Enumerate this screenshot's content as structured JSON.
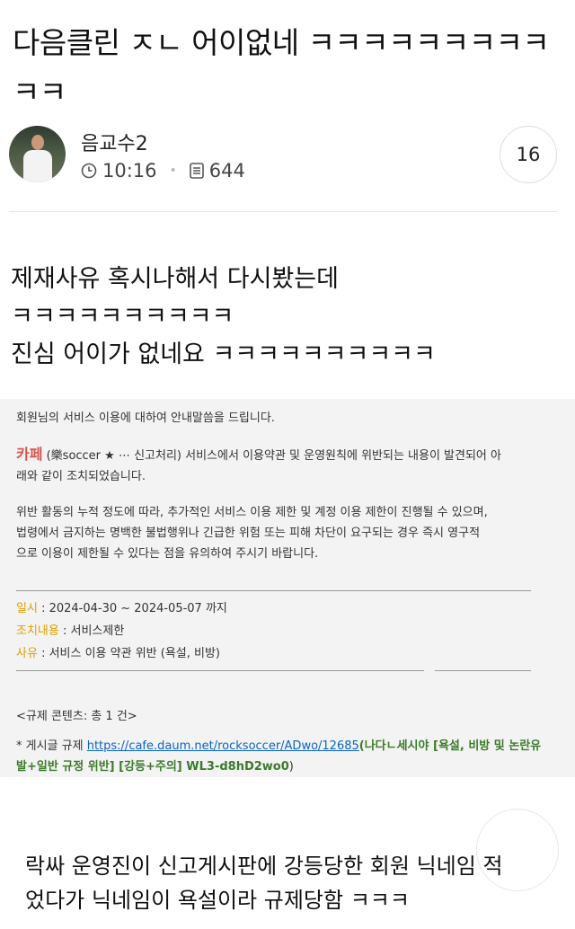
{
  "post": {
    "title": "다음클린 ㅈㄴ 어이없네 ㅋㅋㅋㅋㅋㅋㅋㅋㅋㅋㅋ"
  },
  "author": {
    "name": "음교수2",
    "time": "10:16",
    "views": "644",
    "comment_count": "16",
    "time_icon": "clock-icon",
    "views_icon": "document-icon"
  },
  "body": {
    "line1": "제재사유 혹시나해서 다시봤는데",
    "line2": "ㅋㅋㅋㅋㅋㅋㅋㅋㅋㅋ",
    "line3": "진심 어이가 없네요 ㅋㅋㅋㅋㅋㅋㅋㅋㅋㅋ"
  },
  "notice": {
    "greeting": "회원님의 서비스 이용에 대하여 안내말씀을 드립니다.",
    "cafe_label": "카페",
    "cafe_name": "(樂soccer ★ ⋯ 신고처리)",
    "cafe_text_a": "서비스에서 이용약관 및 운영원칙에 위반되는 내용이 발견되어 아",
    "cafe_text_b": "래와 같이 조치되었습니다.",
    "warning_a": "위반 활동의 누적 정도에 따라, 추가적인 서비스 이용 제한 및 계정 이용 제한이 진행될 수 있으며,",
    "warning_b": "법령에서 금지하는 명백한 불법행위나 긴급한 위험 또는 피해 차단이 요구되는 경우 즉시 영구적",
    "warning_c": "으로 이용이 제한될 수 있다는 점을 유의하여 주시기 바랍니다.",
    "period_label": "일시",
    "period_value": ": 2024-04-30 ~ 2024-05-07 까지",
    "action_label": "조치내용",
    "action_value": ": 서비스제한",
    "reason_label": "사유",
    "reason_value": ": 서비스 이용 약관 위반 (욕설, 비방)",
    "content_count": "<규제 콘텐츠: 총 1 건>",
    "item_prefix": "* 게시글 규제",
    "link": "https://cafe.daum.net/rocksoccer/ADwo/12685",
    "item_blurred": "(나다ㄴ세시",
    "item_tag_a": "야 [욕설, 비방 및 논란유",
    "item_tag_b": "발+일반 규정 위반] [강등+주의] WL3-d8hD2wo0",
    "item_suffix": ")"
  },
  "comment": {
    "line1": "락싸 운영진이 신고게시판에 강등당한 회원 닉네임 적",
    "line2": "었다가 닉네임이 욕설이라 규제당함 ㅋㅋㅋ"
  },
  "colors": {
    "cafe_red": "#d9534f",
    "label_yellow": "#e0a000",
    "link_blue": "#0a66c2",
    "tag_green": "#3b7a2a"
  }
}
